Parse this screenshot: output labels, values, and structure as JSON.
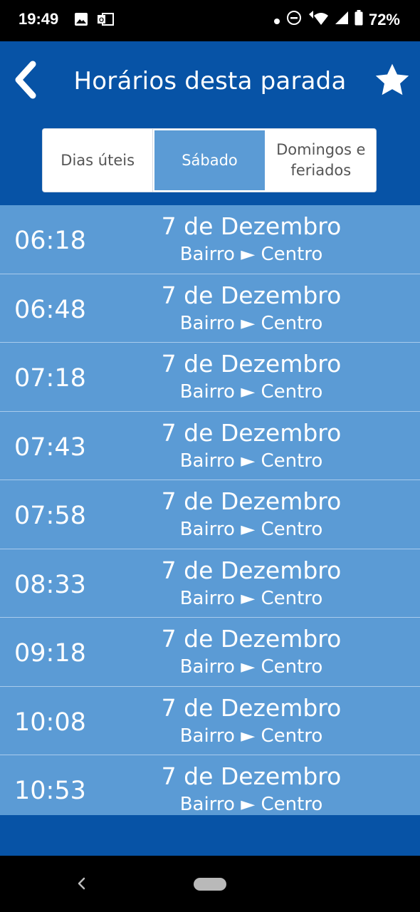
{
  "status_bar": {
    "time": "19:49",
    "battery": "72%",
    "icons": [
      "image-icon",
      "outlook-icon",
      "dot-icon",
      "do-not-disturb-icon",
      "wifi-icon",
      "signal-icon",
      "battery-icon"
    ]
  },
  "header": {
    "title": "Horários desta parada",
    "back_icon": "chevron-left-icon",
    "favorite_icon": "star-icon"
  },
  "tabs": [
    {
      "label": "Dias úteis",
      "active": false
    },
    {
      "label": "Sábado",
      "active": true
    },
    {
      "label": "Domingos e feriados",
      "active": false
    }
  ],
  "schedule": [
    {
      "time": "06:18",
      "line": "7 de Dezembro",
      "direction": "Bairro ► Centro"
    },
    {
      "time": "06:48",
      "line": "7 de Dezembro",
      "direction": "Bairro ► Centro"
    },
    {
      "time": "07:18",
      "line": "7 de Dezembro",
      "direction": "Bairro ► Centro"
    },
    {
      "time": "07:43",
      "line": "7 de Dezembro",
      "direction": "Bairro ► Centro"
    },
    {
      "time": "07:58",
      "line": "7 de Dezembro",
      "direction": "Bairro ► Centro"
    },
    {
      "time": "08:33",
      "line": "7 de Dezembro",
      "direction": "Bairro ► Centro"
    },
    {
      "time": "09:18",
      "line": "7 de Dezembro",
      "direction": "Bairro ► Centro"
    },
    {
      "time": "10:08",
      "line": "7 de Dezembro",
      "direction": "Bairro ► Centro"
    },
    {
      "time": "10:53",
      "line": "7 de Dezembro",
      "direction": "Bairro ► Centro"
    }
  ],
  "colors": {
    "header_bg": "#0753a6",
    "list_bg": "#5b9bd5",
    "active_tab": "#5b9bd5"
  }
}
